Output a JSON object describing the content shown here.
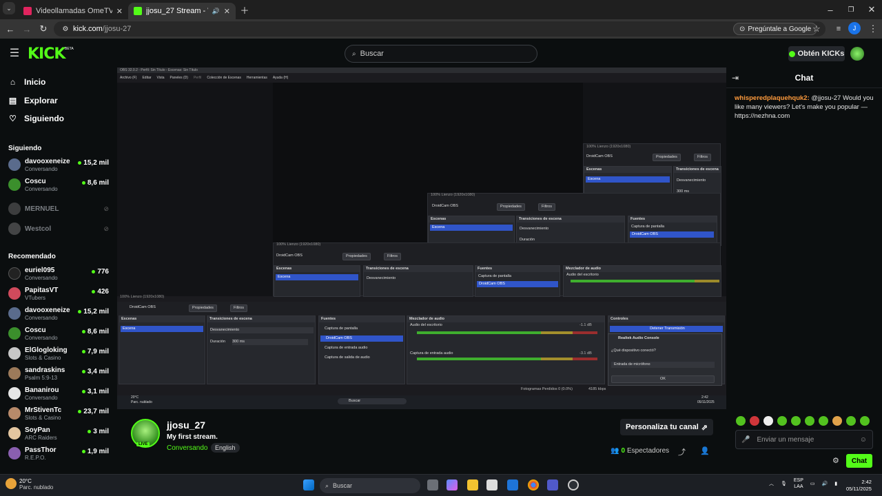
{
  "browser": {
    "tabs": [
      {
        "title": "Videollamadas OmeTV — Alter",
        "active": false
      },
      {
        "title": "jjosu_27 Stream - Watch Liv",
        "active": true
      }
    ],
    "url_host": "kick.com",
    "url_path": "/jjosu-27",
    "ask_google": "Pregúntale a Google",
    "profile_initial": "J"
  },
  "header": {
    "logo": "KICK",
    "beta": "BETA",
    "search_placeholder": "Buscar",
    "kicks_button": "Obtén KICKs"
  },
  "sidebar": {
    "nav": [
      {
        "label": "Inicio",
        "icon": "home-icon"
      },
      {
        "label": "Explorar",
        "icon": "browse-icon"
      },
      {
        "label": "Siguiendo",
        "icon": "heart-icon"
      }
    ],
    "following_title": "Siguiendo",
    "following": [
      {
        "name": "davooxeneize",
        "category": "Conversando",
        "viewers": "15,2 mil",
        "live": true
      },
      {
        "name": "Coscu",
        "category": "Conversando",
        "viewers": "8,6 mil",
        "live": true
      },
      {
        "name": "MERNUEL",
        "category": "",
        "viewers": "",
        "live": false
      },
      {
        "name": "Westcol",
        "category": "",
        "viewers": "",
        "live": false
      }
    ],
    "recommended_title": "Recomendado",
    "recommended": [
      {
        "name": "euriel095",
        "category": "Conversando",
        "viewers": "776"
      },
      {
        "name": "PapitasVT",
        "category": "VTubers",
        "viewers": "426"
      },
      {
        "name": "davooxeneize",
        "category": "Conversando",
        "viewers": "15,2 mil"
      },
      {
        "name": "Coscu",
        "category": "Conversando",
        "viewers": "8,6 mil"
      },
      {
        "name": "ElGlogloking",
        "category": "Slots & Casino",
        "viewers": "7,9 mil"
      },
      {
        "name": "sandraskins",
        "category": "Psalm 5:9-13",
        "viewers": "3,4 mil"
      },
      {
        "name": "Bananirou",
        "category": "Conversando",
        "viewers": "3,1 mil"
      },
      {
        "name": "MrStivenTc",
        "category": "Slots & Casino",
        "viewers": "23,7 mil"
      },
      {
        "name": "SoyPan",
        "category": "ARC Raiders",
        "viewers": "3 mil"
      },
      {
        "name": "PassThor",
        "category": "R.E.P.O.",
        "viewers": "1,9 mil"
      }
    ]
  },
  "obs": {
    "title": "OBS 32.0.2 - Perfil: Sin Título - Escenas: Sin Título",
    "menu": [
      "Archivo (F)",
      "Editar",
      "Vista",
      "Paneles (D)",
      "Perfil",
      "Colección de Escenas",
      "Herramientas",
      "Ayuda (H)"
    ],
    "source_name": "DroidCam OBS",
    "properties": "Propiedades",
    "filters": "Filtros",
    "panels": {
      "scenes": "Escenas",
      "scene_item": "Escena",
      "transitions": "Transiciones de escena",
      "transition_value": "Desvanecimiento",
      "duration_label": "Duración",
      "duration_value": "300 ms",
      "sources": "Fuentes",
      "mixer": "Mezclador de audio",
      "controls": "Controles"
    },
    "sources_list": [
      "Captura de pantalla",
      "DroidCam OBS",
      "Captura de entrada audio",
      "Captura de salida de audio"
    ],
    "mixer": {
      "desktop": "Audio del escritorio",
      "mic": "Captura de entrada audio",
      "desktop_db": "-1.1 dB",
      "mic_db": "-3.1 dB",
      "scale": [
        "-60",
        "-55",
        "-50",
        "-45",
        "-40",
        "-35",
        "-30",
        "-25",
        "-20",
        "-15",
        "-10",
        "-5",
        "0"
      ]
    },
    "canvas_label": "100%   Lienzo (1920x1080)",
    "controls_button": "Detener Transmisión",
    "statusbar": "Fotogramas Perdidos 0 (0.0%)",
    "bitrate": "4185 kbps",
    "dialog": {
      "title": "Realtek Audio Console",
      "question": "¿Qué dispositivo conectó?",
      "option": "Entrada de micrófono",
      "ok": "OK"
    },
    "inner_taskbar_search": "Buscar",
    "inner_weather_temp": "20°C",
    "inner_weather_desc": "Parc. nublado",
    "inner_lang": "ESP\nLAA",
    "inner_time": "2:42",
    "inner_date": "05/11/2025"
  },
  "chat": {
    "title": "Chat",
    "message_user": "whisperedplaquehquk2:",
    "message_text": " @jjosu-27 Would you like many viewers? Let's make you popular — https://nezhna.com",
    "input_placeholder": "Enviar un mensaje",
    "send_button": "Chat"
  },
  "channel": {
    "name": "jjosu_27",
    "stream_title": "My first stream.",
    "category": "Conversando",
    "language": "English",
    "live_badge": "LIVE",
    "customize_button": "Personaliza tu canal",
    "spectators_count": "0",
    "spectators_label": "Espectadores"
  },
  "taskbar": {
    "weather_temp": "20°C",
    "weather_desc": "Parc. nublado",
    "weather_badge": "2",
    "search_placeholder": "Buscar",
    "lang_top": "ESP",
    "lang_bottom": "LAA",
    "time": "2:42",
    "date": "05/11/2025"
  },
  "colors": {
    "kick_green": "#53fc18",
    "bg": "#0b0e0f",
    "obs_selection": "#3055c9"
  }
}
